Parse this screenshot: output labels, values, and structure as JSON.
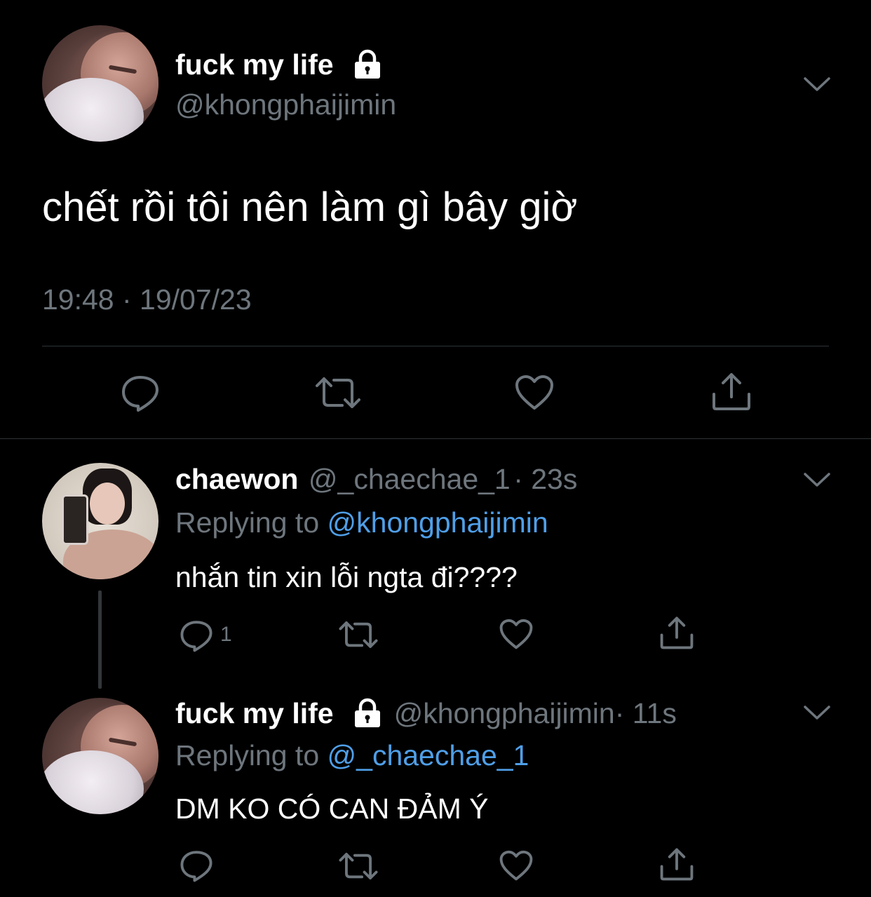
{
  "main_tweet": {
    "display_name": "fuck my life",
    "handle": "@khongphaijimin",
    "text": "chết rồi tôi nên làm gì bây giờ",
    "timestamp": "19:48 · 19/07/23",
    "protected_icon": "lock-icon"
  },
  "replies": [
    {
      "display_name": "chaewon",
      "handle": "@_chaechae_1",
      "time": "· 23s",
      "replying_prefix": "Replying to ",
      "replying_to": "@khongphaijimin",
      "text": "nhắn tin xin lỗi ngta đi????",
      "reply_count": "1"
    },
    {
      "display_name": "fuck my life",
      "handle": "@khongphaijimin",
      "time": "· 11s",
      "replying_prefix": "Replying to ",
      "replying_to": "@_chaechae_1",
      "text": "DM KO CÓ CAN ĐẢM Ý",
      "reply_count": ""
    }
  ],
  "icons": {
    "reply": "reply-icon",
    "retweet": "retweet-icon",
    "like": "like-icon",
    "share": "share-icon",
    "more": "chevron-down-icon"
  },
  "colors": {
    "background": "#000000",
    "text": "#ffffff",
    "secondary": "#6e767d",
    "link": "#4f9fe8",
    "divider": "#2f3336"
  }
}
